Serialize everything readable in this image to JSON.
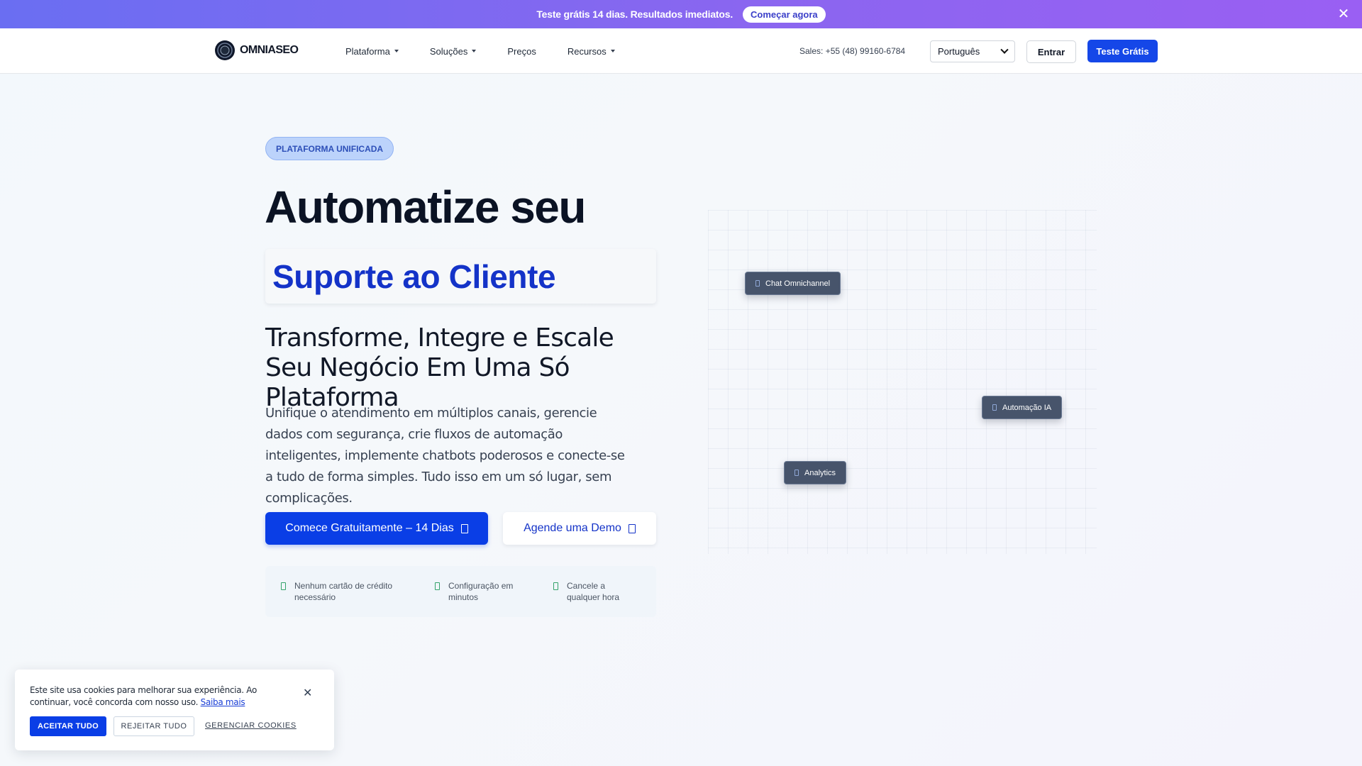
{
  "promo": {
    "text": "Teste grátis 14 dias. Resultados imediatos.",
    "button": "Começar agora",
    "close_icon": "close-icon"
  },
  "nav": {
    "logo_text": "OMNIASEO",
    "menu": [
      {
        "label": "Plataforma",
        "dropdown": true
      },
      {
        "label": "Soluções",
        "dropdown": true
      },
      {
        "label": "Preços",
        "dropdown": false
      },
      {
        "label": "Recursos",
        "dropdown": true
      }
    ],
    "sales": "Sales: +55 (48) 99160-6784",
    "language": "Português",
    "login": "Entrar",
    "trial": "Teste Grátis"
  },
  "hero": {
    "badge": "PLATAFORMA UNIFICADA",
    "title": "Automatize seu",
    "highlight": "Suporte ao Cliente",
    "subtitle": "Transforme, Integre e Escale Seu Negócio Em Uma Só Plataforma",
    "description": "Unifique o atendimento em múltiplos canais, gerencie dados com segurança, crie fluxos de automação inteligentes, implemente chatbots poderosos e conecte-se a tudo de forma simples. Tudo isso em um só lugar, sem complicações.",
    "cta_primary": "Comece Gratuitamente – 14 Dias",
    "cta_secondary": "Agende uma Demo",
    "perks": [
      "Nenhum cartão de crédito necessário",
      "Configuração em minutos",
      "Cancele a qualquer hora"
    ]
  },
  "visual": {
    "chips": [
      "Chat Omnichannel",
      "Automação IA",
      "Analytics"
    ]
  },
  "cookie": {
    "text": "Este site usa cookies para melhorar sua experiência. Ao continuar, você concorda com nosso uso.",
    "link": "Saiba mais",
    "accept": "ACEITAR TUDO",
    "reject": "REJEITAR TUDO",
    "manage": "GERENCIAR COOKIES"
  },
  "colors": {
    "brand_blue": "#0a3ee6",
    "highlight_text": "#1433c8",
    "promo_gradient_start": "#6a6ef2",
    "promo_gradient_end": "#9a5ff3"
  }
}
